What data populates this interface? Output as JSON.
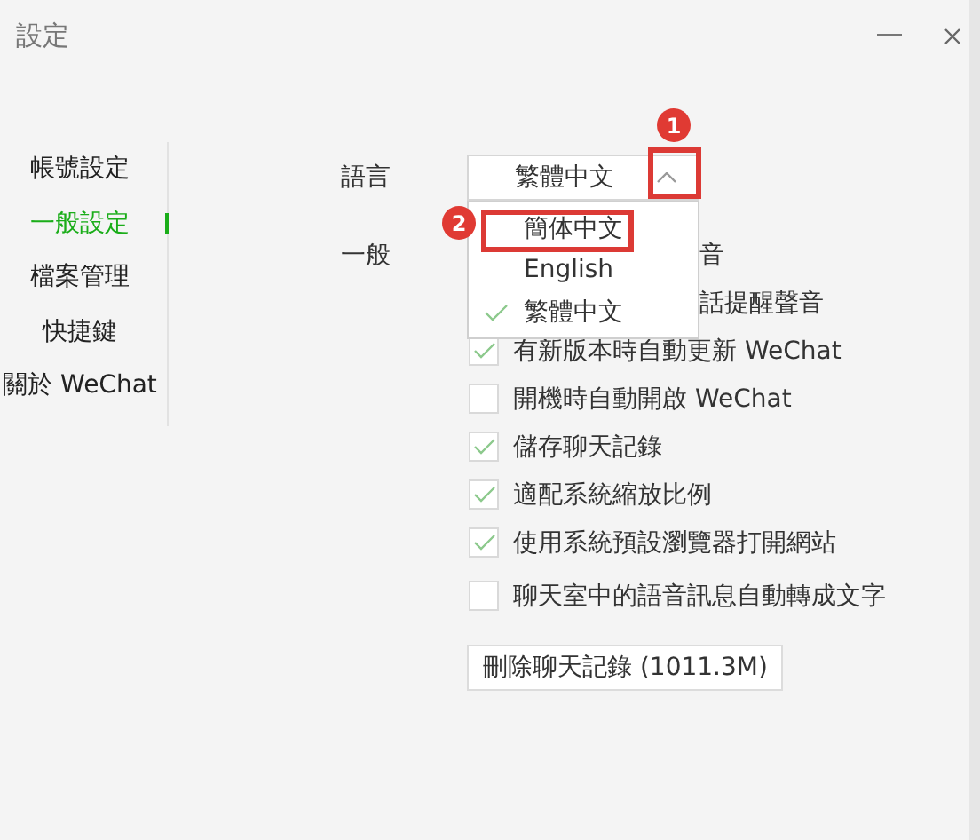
{
  "window": {
    "title": "設定"
  },
  "sidebar": {
    "items": [
      {
        "label": "帳號設定",
        "selected": false
      },
      {
        "label": "一般設定",
        "selected": true
      },
      {
        "label": "檔案管理",
        "selected": false
      },
      {
        "label": "快捷鍵",
        "selected": false
      },
      {
        "label": "關於 WeChat",
        "selected": false
      }
    ]
  },
  "language": {
    "label": "語言",
    "value": "繁體中文",
    "expanded": true,
    "options": [
      {
        "label": "簡体中文",
        "checked": false
      },
      {
        "label": "English",
        "checked": false
      },
      {
        "label": "繁體中文",
        "checked": true
      }
    ]
  },
  "general": {
    "label": "一般",
    "options": [
      {
        "kind": "covered",
        "label": "音"
      },
      {
        "kind": "covered",
        "label": "話提醒聲音"
      },
      {
        "kind": "checkbox",
        "label": "有新版本時自動更新 WeChat",
        "checked": true
      },
      {
        "kind": "checkbox",
        "label": "開機時自動開啟 WeChat",
        "checked": false
      },
      {
        "kind": "checkbox",
        "label": "儲存聊天記錄",
        "checked": true
      },
      {
        "kind": "checkbox",
        "label": "適配系統縮放比例",
        "checked": true
      },
      {
        "kind": "checkbox",
        "label": "使用系統預設瀏覽器打開網站",
        "checked": true
      },
      {
        "kind": "checkbox",
        "label": "聊天室中的語音訊息自動轉成文字",
        "checked": false
      }
    ]
  },
  "delete_button": "刪除聊天記錄 (1011.3M)",
  "annotations": [
    {
      "kind": "arrow",
      "badge": "1"
    },
    {
      "kind": "option",
      "badge": "2"
    }
  ]
}
